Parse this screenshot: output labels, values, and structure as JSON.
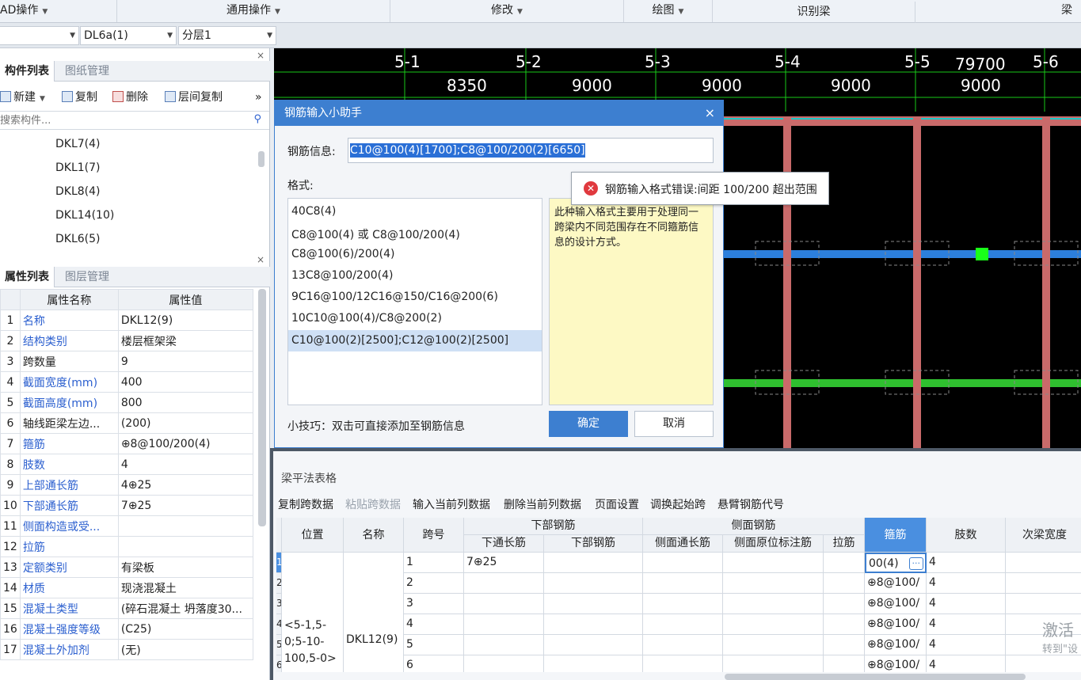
{
  "menubar": {
    "items": [
      "AD操作",
      "通用操作",
      "修改",
      "绘图",
      "识别梁",
      "梁"
    ]
  },
  "selbar": {
    "combo1": "",
    "combo2": "DL6a(1)",
    "combo3": "分层1"
  },
  "component_panel": {
    "tab_active": "构件列表",
    "tab_inactive": "图纸管理",
    "close": "×",
    "tools": {
      "new": "新建",
      "copy": "复制",
      "delete": "删除",
      "floor_copy": "层间复制",
      "more": "»"
    },
    "search_placeholder": "搜索构件...",
    "items": [
      "DKL7(4)",
      "DKL1(7)",
      "DKL8(4)",
      "DKL14(10)",
      "DKL6(5)"
    ]
  },
  "property_panel": {
    "tab_active": "属性列表",
    "tab_inactive": "图层管理",
    "close": "×",
    "col_name": "属性名称",
    "col_value": "属性值",
    "rows": [
      {
        "n": "1",
        "name": "名称",
        "value": "DKL12(9)",
        "blue": true
      },
      {
        "n": "2",
        "name": "结构类别",
        "value": "楼层框架梁",
        "blue": true
      },
      {
        "n": "3",
        "name": "跨数量",
        "value": "9",
        "blue": false
      },
      {
        "n": "4",
        "name": "截面宽度(mm)",
        "value": "400",
        "blue": true
      },
      {
        "n": "5",
        "name": "截面高度(mm)",
        "value": "800",
        "blue": true
      },
      {
        "n": "6",
        "name": "轴线距梁左边...",
        "value": "(200)",
        "blue": false
      },
      {
        "n": "7",
        "name": "箍筋",
        "value": "⊕8@100/200(4)",
        "blue": true
      },
      {
        "n": "8",
        "name": "肢数",
        "value": "4",
        "blue": true
      },
      {
        "n": "9",
        "name": "上部通长筋",
        "value": "4⊕25",
        "blue": true
      },
      {
        "n": "10",
        "name": "下部通长筋",
        "value": "7⊕25",
        "blue": true
      },
      {
        "n": "11",
        "name": "侧面构造或受...",
        "value": "",
        "blue": true
      },
      {
        "n": "12",
        "name": "拉筋",
        "value": "",
        "blue": true
      },
      {
        "n": "13",
        "name": "定额类别",
        "value": "有梁板",
        "blue": true
      },
      {
        "n": "14",
        "name": "材质",
        "value": "现浇混凝土",
        "blue": true
      },
      {
        "n": "15",
        "name": "混凝土类型",
        "value": "(碎石混凝土 坍落度30...",
        "blue": true
      },
      {
        "n": "16",
        "name": "混凝土强度等级",
        "value": "(C25)",
        "blue": true
      },
      {
        "n": "17",
        "name": "混凝土外加剂",
        "value": "(无)",
        "blue": true
      }
    ]
  },
  "cad": {
    "axes": [
      "5-1",
      "5-2",
      "5-3",
      "5-4",
      "5-5",
      "5-6"
    ],
    "spans": [
      "8350",
      "9000",
      "9000",
      "9000",
      "9000"
    ],
    "total": "79700"
  },
  "dialog": {
    "title": "钢筋输入小助手",
    "close": "×",
    "info_label": "钢筋信息:",
    "info_value": "C10@100(4)[1700];C8@100/200(2)[6650]",
    "format_label": "格式:",
    "formats": [
      "40C8(4)",
      "C8@100(4) 或 C8@100/200(4)",
      "C8@100(6)/200(4)",
      "13C8@100/200(4)",
      "9C16@100/12C16@150/C16@200(6)",
      "10C10@100(4)/C8@200(2)",
      "C10@100(2)[2500];C12@100(2)[2500]"
    ],
    "description": "此种输入格式主要用于处理同一跨梁内不同范围存在不同箍筋信息的设计方式。",
    "tip": "小技巧：双击可直接添加至钢筋信息",
    "ok": "确定",
    "cancel": "取消"
  },
  "error": {
    "message": "钢筋输入格式错误:间距 100/200 超出范围"
  },
  "bottom_panel": {
    "title": "梁平法表格",
    "toolbar": [
      "复制跨数据",
      "粘贴跨数据",
      "输入当前列数据",
      "删除当前列数据",
      "页面设置",
      "调换起始跨",
      "悬臂钢筋代号"
    ],
    "headers": {
      "position": "位置",
      "name": "名称",
      "span": "跨号",
      "bottom_group": "下部钢筋",
      "bottom_cont": "下通长筋",
      "bottom_rebar": "下部钢筋",
      "side_group": "侧面钢筋",
      "side_cont": "侧面通长筋",
      "side_mark": "侧面原位标注筋",
      "tie": "拉筋",
      "stirrup": "箍筋",
      "legs": "肢数",
      "sec_width": "次梁宽度"
    },
    "position_value": "<5-1,5-0;5-10-100,5-0>",
    "name_value": "DKL12(9)",
    "rows": [
      {
        "idx": "1",
        "span": "1",
        "bottom_cont": "7⊕25",
        "stirrup": "00(4)",
        "legs": "4"
      },
      {
        "idx": "2",
        "span": "2",
        "bottom_cont": "",
        "stirrup": "⊕8@100/",
        "legs": "4"
      },
      {
        "idx": "3",
        "span": "3",
        "bottom_cont": "",
        "stirrup": "⊕8@100/",
        "legs": "4"
      },
      {
        "idx": "4",
        "span": "4",
        "bottom_cont": "",
        "stirrup": "⊕8@100/",
        "legs": "4"
      },
      {
        "idx": "5",
        "span": "5",
        "bottom_cont": "",
        "stirrup": "⊕8@100/",
        "legs": "4"
      },
      {
        "idx": "6",
        "span": "6",
        "bottom_cont": "",
        "stirrup": "⊕8@100/",
        "legs": "4"
      }
    ],
    "ellipsis": "···"
  },
  "watermark": {
    "line1": "激活",
    "line2": "转到\"设"
  }
}
